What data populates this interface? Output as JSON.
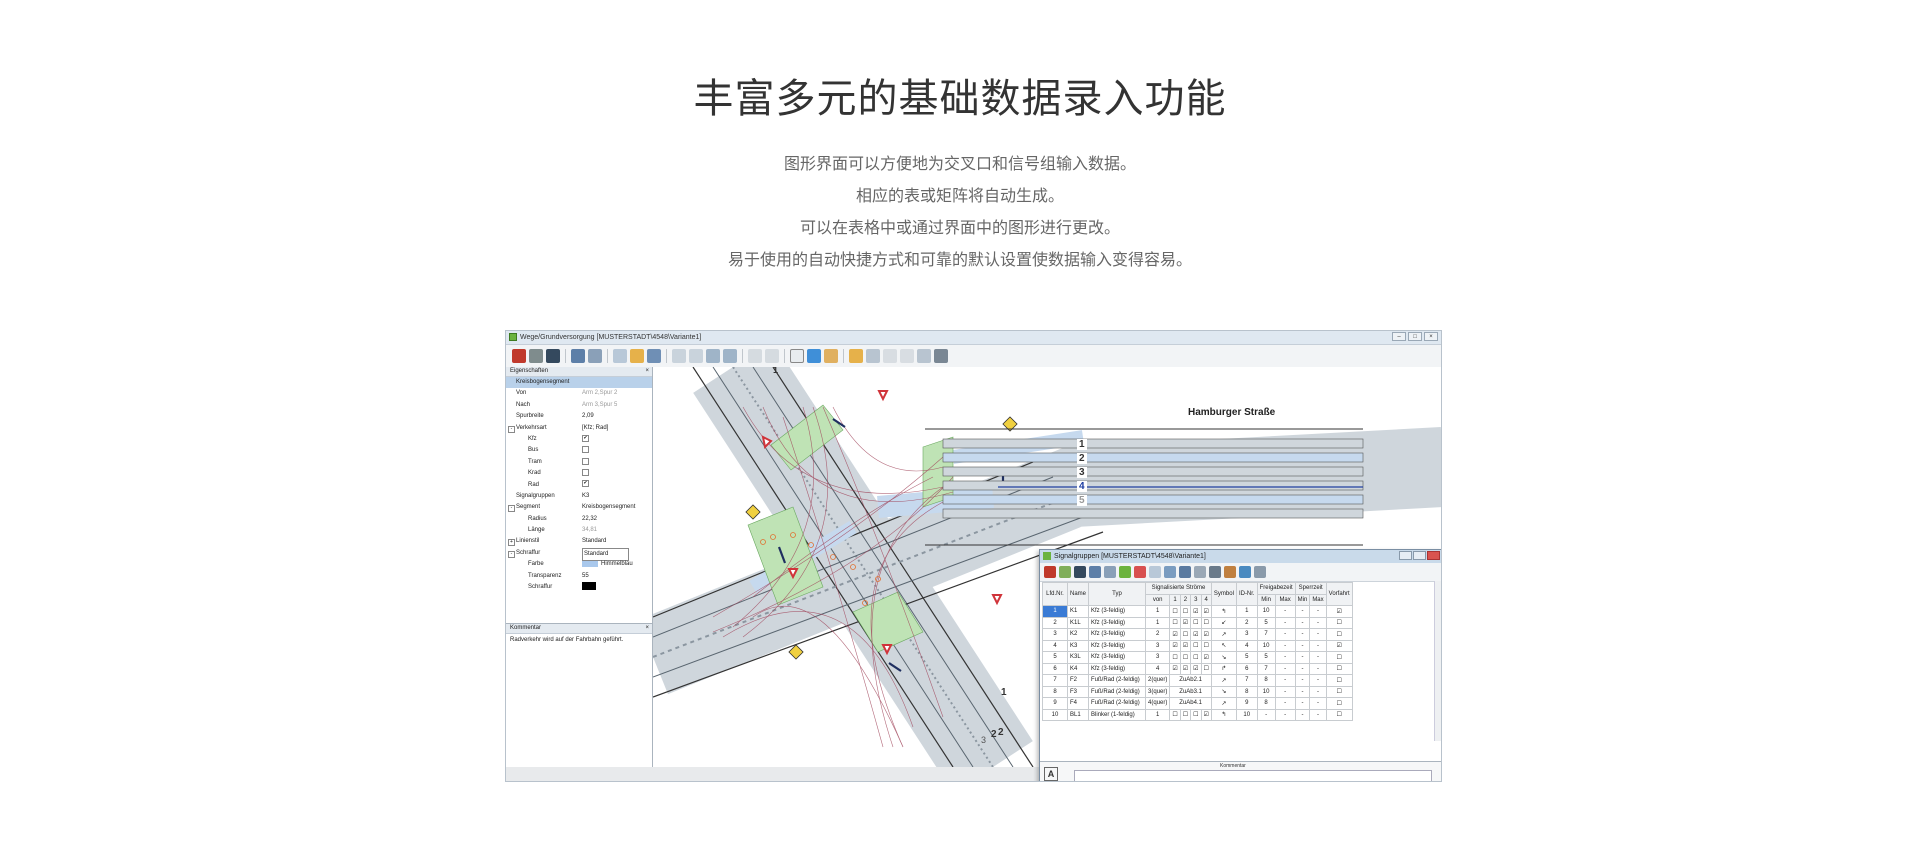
{
  "heading": "丰富多元的基础数据录入功能",
  "description": [
    "图形界面可以方便地为交叉口和信号组输入数据。",
    "相应的表或矩阵将自动生成。",
    "可以在表格中或通过界面中的图形进行更改。",
    "易于使用的自动快捷方式和可靠的默认设置使数据输入变得容易。"
  ],
  "window": {
    "title": "Wege/Grundversorgung [MUSTERSTADT\\4548\\Variante1]",
    "controls": [
      "minimize",
      "maximize",
      "close"
    ]
  },
  "properties_panel": {
    "title": "Eigenschaften",
    "close": "×",
    "header": "Kreisbogensegment",
    "rows": [
      {
        "key": "Von",
        "value": "Arm 2,Spur 2"
      },
      {
        "key": "Nach",
        "value": "Arm 3,Spur 5"
      },
      {
        "key": "Spurbreite",
        "value": "2,09"
      },
      {
        "key": "Verkehrsart",
        "value": "[Kfz; Rad]"
      },
      {
        "key": "Kfz",
        "value": "✔"
      },
      {
        "key": "Bus",
        "value": ""
      },
      {
        "key": "Tram",
        "value": ""
      },
      {
        "key": "Krad",
        "value": ""
      },
      {
        "key": "Rad",
        "value": "✔"
      },
      {
        "key": "Signalgruppen",
        "value": "K3"
      },
      {
        "key": "Segment",
        "value": "Kreisbogensegment"
      },
      {
        "key": "Radius",
        "value": "22,32"
      },
      {
        "key": "Länge",
        "value": "34,81"
      },
      {
        "key": "Linienstil",
        "value": "Standard"
      },
      {
        "key": "Schraffur",
        "value": "Standard"
      },
      {
        "key": "Farbe",
        "value": "Himmelblau"
      },
      {
        "key": "Transparenz",
        "value": "55"
      },
      {
        "key": "Schraffur",
        "value": ""
      }
    ],
    "colors": {
      "farbe": "#a9c8ec",
      "schraffur": "#000000"
    }
  },
  "comment_panel": {
    "title": "Kommentar",
    "close": "×",
    "text": "Radverkehr wird auf der Fahrbahn geführt."
  },
  "map": {
    "street_name": "Hamburger Straße",
    "lane_numbers": [
      "1",
      "2",
      "3",
      "4",
      "5"
    ],
    "arm_labels": [
      "1",
      "1",
      "2",
      "2",
      "3"
    ]
  },
  "signal_dialog": {
    "title": "Signalgruppen [MUSTERSTADT\\4548\\Variante1]",
    "headers": {
      "lfd": "Lfd.Nr.",
      "name": "Name",
      "typ": "Typ",
      "streams": "Signalisierte Ströme",
      "von": "von",
      "s1": "1",
      "s2": "2",
      "s3": "3",
      "s4": "4",
      "symbol": "Symbol",
      "id": "ID-Nr.",
      "freigabe": "Freigabezeit",
      "sperr": "Sperrzeit",
      "min": "Min",
      "max": "Max",
      "vorfahrt": "Vorfahrt"
    },
    "rows": [
      {
        "nr": "1",
        "name": "K1",
        "typ": "Kfz (3-feldig)",
        "von": "1",
        "s": [
          "☐",
          "☐",
          "☑",
          "☑"
        ],
        "sym": "↰",
        "id": "1",
        "fmin": "10",
        "fmax": "-",
        "smin": "-",
        "smax": "-",
        "vf": "☑"
      },
      {
        "nr": "2",
        "name": "K1L",
        "typ": "Kfz (3-feldig)",
        "von": "1",
        "s": [
          "☐",
          "☑",
          "☐",
          "☐"
        ],
        "sym": "↙",
        "id": "2",
        "fmin": "5",
        "fmax": "-",
        "smin": "-",
        "smax": "-",
        "vf": "☐"
      },
      {
        "nr": "3",
        "name": "K2",
        "typ": "Kfz (3-feldig)",
        "von": "2",
        "s": [
          "☑",
          "☐",
          "☑",
          "☑"
        ],
        "sym": "↗",
        "id": "3",
        "fmin": "7",
        "fmax": "-",
        "smin": "-",
        "smax": "-",
        "vf": "☐"
      },
      {
        "nr": "4",
        "name": "K3",
        "typ": "Kfz (3-feldig)",
        "von": "3",
        "s": [
          "☑",
          "☑",
          "☐",
          "☐"
        ],
        "sym": "↖",
        "id": "4",
        "fmin": "10",
        "fmax": "-",
        "smin": "-",
        "smax": "-",
        "vf": "☑"
      },
      {
        "nr": "5",
        "name": "K3L",
        "typ": "Kfz (3-feldig)",
        "von": "3",
        "s": [
          "☐",
          "☐",
          "☐",
          "☑"
        ],
        "sym": "↘",
        "id": "5",
        "fmin": "5",
        "fmax": "-",
        "smin": "-",
        "smax": "-",
        "vf": "☐"
      },
      {
        "nr": "6",
        "name": "K4",
        "typ": "Kfz (3-feldig)",
        "von": "4",
        "s": [
          "☑",
          "☑",
          "☑",
          "☐"
        ],
        "sym": "↱",
        "id": "6",
        "fmin": "7",
        "fmax": "-",
        "smin": "-",
        "smax": "-",
        "vf": "☐"
      },
      {
        "nr": "7",
        "name": "F2",
        "typ": "Fuß/Rad (2-feldig)",
        "von": "2(quer)",
        "s": [
          "ZuAb2.1"
        ],
        "sym": "↗",
        "id": "7",
        "fmin": "8",
        "fmax": "-",
        "smin": "-",
        "smax": "-",
        "vf": "☐"
      },
      {
        "nr": "8",
        "name": "F3",
        "typ": "Fuß/Rad (2-feldig)",
        "von": "3(quer)",
        "s": [
          "ZuAb3.1"
        ],
        "sym": "↘",
        "id": "8",
        "fmin": "10",
        "fmax": "-",
        "smin": "-",
        "smax": "-",
        "vf": "☐"
      },
      {
        "nr": "9",
        "name": "F4",
        "typ": "Fuß/Rad (2-feldig)",
        "von": "4(quer)",
        "s": [
          "ZuAb4.1"
        ],
        "sym": "↗",
        "id": "9",
        "fmin": "8",
        "fmax": "-",
        "smin": "-",
        "smax": "-",
        "vf": "☐"
      },
      {
        "nr": "10",
        "name": "BL1",
        "typ": "Blinker (1-feldig)",
        "von": "1",
        "s": [
          "☐",
          "☐",
          "☐",
          "☑"
        ],
        "sym": "↰",
        "id": "10",
        "fmin": "-",
        "fmax": "-",
        "smin": "-",
        "smax": "-",
        "vf": "☐"
      }
    ],
    "comment_label": "Kommentar",
    "a_button": "A"
  }
}
